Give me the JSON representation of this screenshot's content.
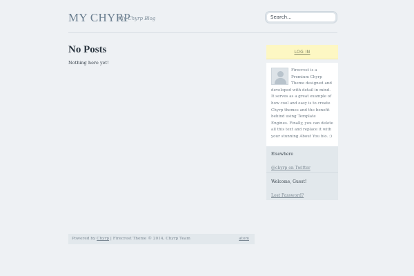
{
  "header": {
    "site_title": "MY CHYRP",
    "site_description": "My Chyrp Blog",
    "search_placeholder": "Search..."
  },
  "main": {
    "heading": "No Posts",
    "body": "Nothing here yet!"
  },
  "sidebar": {
    "login_label": "LOG IN",
    "about_text": "Firecrest is a Premium Chyrp Theme designed and developed with detail in mind. It serves as a great example of how cool and easy is to create Chyrp themes and the benefit behind using Template Engines. Finally, you can delete all this text and replace it with your stunning About You bio. :)",
    "elsewhere_title": "Elsewhere",
    "elsewhere_link": "@chyrp on Twitter",
    "welcome_title": "Welcome, Guest!",
    "lost_password_link": "Lost Password?"
  },
  "footer": {
    "powered_by": "Powered by",
    "chyrp_link": "Chyrp",
    "credits": "| Firecrest Theme © 2014, Chyrp Team",
    "atom_link": "atom"
  },
  "colors": {
    "background": "#eef1f4",
    "login_highlight": "#fdf7c3",
    "sidebar_panel": "#e2e8ec"
  }
}
